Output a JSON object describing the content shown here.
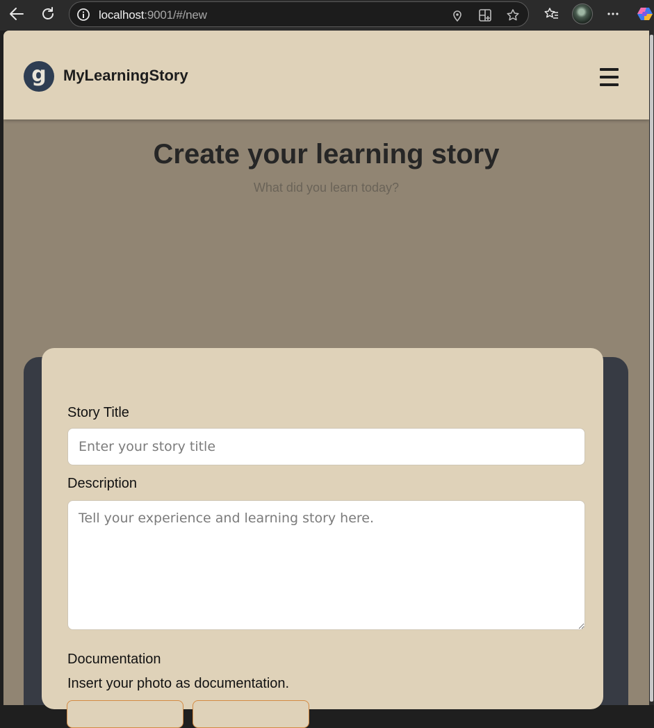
{
  "browser": {
    "url_host": "localhost",
    "url_path": ":9001/#/new"
  },
  "header": {
    "logo_letter": "g",
    "brand_name": "MyLearningStory"
  },
  "hero": {
    "title": "Create your learning story",
    "subtitle": "What did you learn today?"
  },
  "form": {
    "title_label": "Story Title",
    "title_placeholder": "Enter your story title",
    "title_value": "",
    "description_label": "Description",
    "description_placeholder": "Tell your experience and learning story here.",
    "description_value": "",
    "documentation_label": "Documentation",
    "documentation_hint": "Insert your photo as documentation."
  },
  "colors": {
    "nav_background": "#dfd2b9",
    "page_background": "#918573",
    "card_dark": "#373b44",
    "logo_background": "#2e3d52",
    "button_border": "#d48a43"
  }
}
